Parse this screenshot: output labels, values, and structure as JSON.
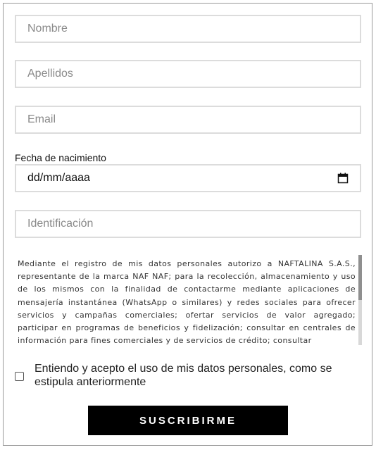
{
  "form": {
    "nombre_placeholder": "Nombre",
    "apellidos_placeholder": "Apellidos",
    "email_placeholder": "Email",
    "birthdate_label": "Fecha de nacimiento",
    "birthdate_value": "dd/mm/aaaa",
    "identificacion_placeholder": "Identificación",
    "terms_text": "Mediante el registro de mis datos personales autorizo a NAFTALINA S.A.S., representante de la marca NAF NAF; para la recolección, almacenamiento y uso de los mismos con la finalidad de contactarme mediante aplicaciones de mensajería instantánea (WhatsApp o similares) y redes sociales para ofrecer servicios y campañas comerciales; ofertar servicios de valor agregado; participar en programas de beneficios y fidelización; consultar en centrales de información para fines comerciales y de servicios de crédito; consultar",
    "consent_label": "Entiendo y acepto el uso de mis datos personales, como se estipula anteriormente",
    "submit_label": "SUSCRIBIRME"
  },
  "icons": {
    "calendar": "calendar-icon"
  },
  "colors": {
    "border": "#dcdcdc",
    "button_bg": "#000000",
    "button_text": "#ffffff"
  }
}
